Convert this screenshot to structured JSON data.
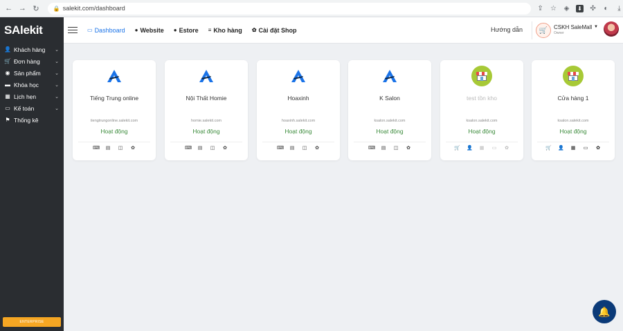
{
  "browser": {
    "url": "salekit.com/dashboard"
  },
  "sidebar": {
    "logo": "SAlekit",
    "items": [
      {
        "label": "Khách hàng",
        "icon": "user-icon",
        "glyph": "👤",
        "has_chevron": true
      },
      {
        "label": "Đơn hàng",
        "icon": "cart-icon",
        "glyph": "🛒",
        "has_chevron": true
      },
      {
        "label": "Sản phẩm",
        "icon": "product-icon",
        "glyph": "◉",
        "has_chevron": true
      },
      {
        "label": "Khóa học",
        "icon": "book-icon",
        "glyph": "▬",
        "has_chevron": true
      },
      {
        "label": "Lịch hẹn",
        "icon": "calendar-icon",
        "glyph": "▦",
        "has_chevron": true
      },
      {
        "label": "Kế toán",
        "icon": "card-icon",
        "glyph": "▭",
        "has_chevron": true
      },
      {
        "label": "Thống kê",
        "icon": "flag-icon",
        "glyph": "⚑",
        "has_chevron": false
      }
    ],
    "bottom_button": "ENTERPRISE"
  },
  "header": {
    "nav": [
      {
        "label": "Dashboard",
        "icon": "monitor-icon",
        "glyph": "▭",
        "active": true
      },
      {
        "label": "Website",
        "icon": "globe-icon",
        "glyph": "●",
        "active": false
      },
      {
        "label": "Estore",
        "icon": "globe-icon",
        "glyph": "●",
        "active": false
      },
      {
        "label": "Kho hàng",
        "icon": "database-icon",
        "glyph": "≡",
        "active": false
      },
      {
        "label": "Cài đặt Shop",
        "icon": "gear-icon",
        "glyph": "✿",
        "active": false
      }
    ],
    "guide": "Hướng dẫn",
    "account": {
      "name": "CSKH SaleMall",
      "role": "Owner"
    }
  },
  "cards": [
    {
      "title": "Tiếng Trung online",
      "domain": "tiengtrungonline.salekit.com",
      "status": "Hoạt động",
      "logo": "salekit-logo-icon",
      "muted": false,
      "icons": [
        "keyboard-icon",
        "list-icon",
        "layout-icon",
        "gear-icon"
      ]
    },
    {
      "title": "Nội Thất Homie",
      "domain": "homie.salekit.com",
      "status": "Hoạt động",
      "logo": "salekit-logo-icon",
      "muted": false,
      "icons": [
        "keyboard-icon",
        "list-icon",
        "layout-icon",
        "gear-icon"
      ]
    },
    {
      "title": "Hoaxinh",
      "domain": "hoaxinh.salekit.com",
      "status": "Hoạt động",
      "logo": "salekit-logo-icon",
      "muted": false,
      "icons": [
        "keyboard-icon",
        "list-icon",
        "layout-icon",
        "gear-icon"
      ]
    },
    {
      "title": "K Salon",
      "domain": "ksalon.salekit.com",
      "status": "Hoạt động",
      "logo": "salekit-logo-icon",
      "muted": false,
      "icons": [
        "keyboard-icon",
        "list-icon",
        "layout-icon",
        "gear-icon"
      ]
    },
    {
      "title": "test tồn kho",
      "domain": "ksalon.salekit.com",
      "status": "Hoạt động",
      "logo": "store-icon",
      "muted": true,
      "icons": [
        "cart-icon",
        "user-icon",
        "calendar-icon",
        "card-icon",
        "gear-icon"
      ]
    },
    {
      "title": "Cửa hàng 1",
      "domain": "ksalon.salekit.com",
      "status": "Hoạt động",
      "logo": "store-icon",
      "muted": false,
      "icons": [
        "cart-icon",
        "user-icon",
        "calendar-icon",
        "card-icon",
        "gear-icon"
      ]
    }
  ],
  "colors": {
    "sidebar_bg": "#2a2d31",
    "active_nav": "#1a73e8",
    "status_green": "#3a8a3a",
    "brand_blue": "#1a73e8",
    "store_green": "#a7c936",
    "enterprise_orange": "#f5a623",
    "chat_navy": "#0b3a78"
  }
}
